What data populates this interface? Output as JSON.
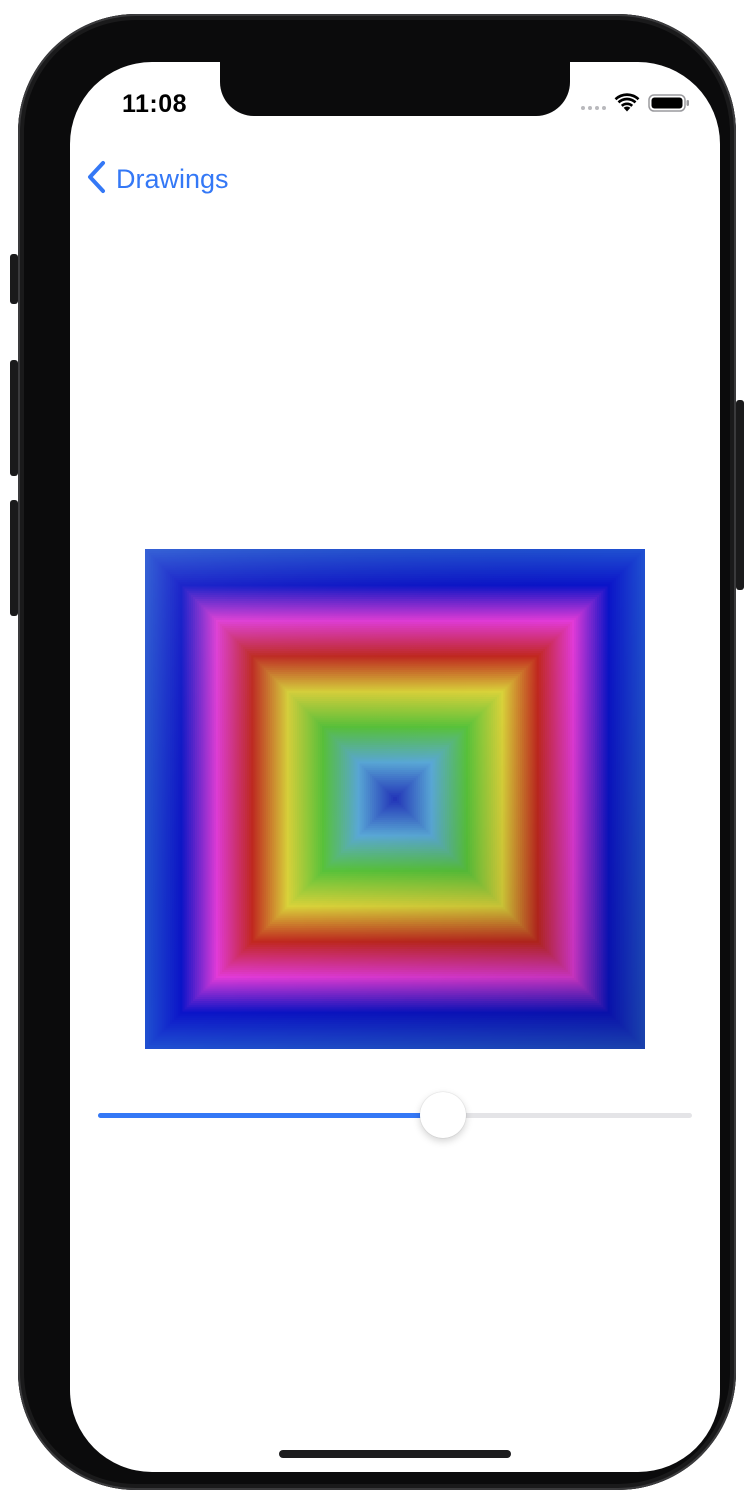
{
  "status_bar": {
    "time": "11:08",
    "wifi_icon": "wifi-icon",
    "battery_icon": "battery-icon",
    "signal_icon": "cellular-signal-icon"
  },
  "nav": {
    "back_label": "Drawings",
    "back_icon": "chevron-left-icon"
  },
  "drawing": {
    "type": "concentric-square-gradient",
    "gradient_colors": [
      "#1f4fd1",
      "#0b14c9",
      "#e23ad8",
      "#c1281f",
      "#d9d23a",
      "#58c23a",
      "#59a7d6",
      "#2336b8"
    ]
  },
  "slider": {
    "value": 0.58
  },
  "colors": {
    "accent": "#3478f6",
    "track": "#e4e4e7",
    "device": "#0b0b0c"
  }
}
